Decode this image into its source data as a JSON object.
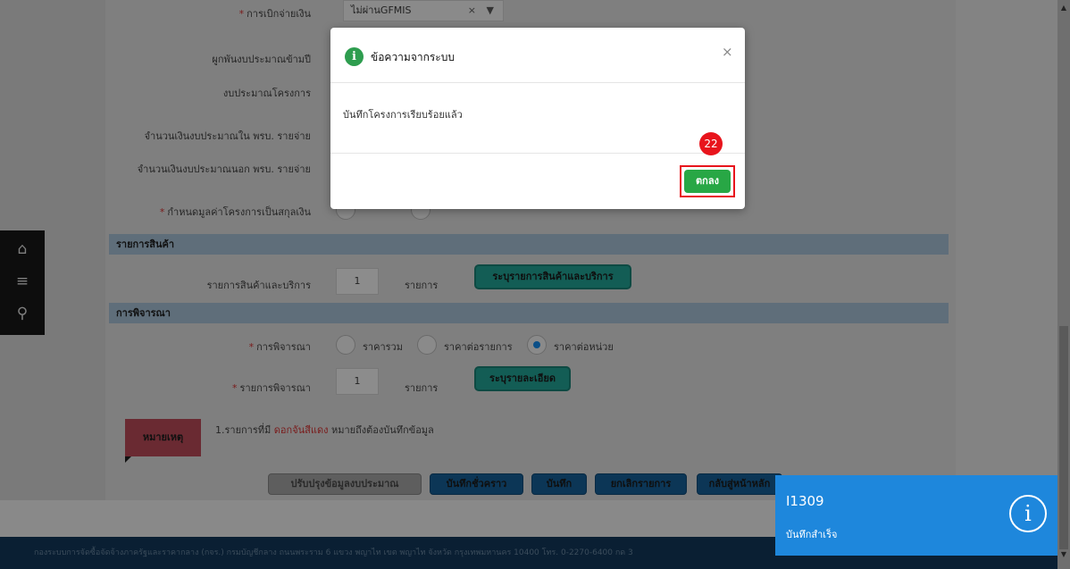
{
  "form": {
    "gfmis_label": "การเบิกจ่ายเงิน",
    "gfmis_value": "ไม่ผ่านGFMIS",
    "gfmis_clear": "×",
    "gfmis_caret": "▼",
    "budget_binding_label": "ผูกพันงบประมาณข้ามปี",
    "project_budget_label": "งบประมาณโครงการ",
    "budget_in_label": "จำนวนเงินงบประมาณใน พรบ. รายจ่าย",
    "budget_out_label": "จำนวนเงินงบประมาณนอก พรบ. รายจ่าย",
    "emergency_label": "กำหนดมูลค่าโครงการเป็นสกุลเงิน"
  },
  "sections": {
    "items_title": "รายการสินค้า",
    "consider_title": "การพิจารณา"
  },
  "items": {
    "label": "รายการสินค้าและบริการ",
    "count": "1",
    "unit": "รายการ",
    "button": "ระบุรายการสินค้าและบริการ"
  },
  "consider": {
    "method_label": "การพิจารณา",
    "options": [
      "ราคารวม",
      "ราคาต่อรายการ",
      "ราคาต่อหน่วย"
    ],
    "selected": "ราคาต่อหน่วย",
    "list_label": "รายการพิจารณา",
    "count": "1",
    "unit": "รายการ",
    "detail_button": "ระบุรายละเอียด"
  },
  "note": {
    "tag": "หมายเหตุ",
    "text_prefix": "1.รายการที่มี ",
    "text_red": "ดอกจันสีแดง",
    "text_suffix": " หมายถึงต้องบันทึกข้อมูล"
  },
  "actions": {
    "update_budget": "ปรับปรุงข้อมูลงบประมาณ",
    "save_draft": "บันทึกชั่วคราว",
    "save": "บันทึก",
    "cancel": "ยกเลิกรายการ",
    "back": "กลับสู่หน้าหลัก"
  },
  "modal": {
    "title": "ข้อความจากระบบ",
    "info_glyph": "i",
    "close": "×",
    "message": "บันทึกโครงการเรียบร้อยแล้ว",
    "ok": "ตกลง"
  },
  "step_badge": "22",
  "toast": {
    "code": "I1309",
    "message": "บันทึกสำเร็จ",
    "icon": "i"
  },
  "sidebar": {
    "home_icon": "⌂",
    "menu_icon": "≡",
    "search_icon": "⚲"
  },
  "footer": {
    "text": "กองระบบการจัดซื้อจัดจ้างภาครัฐและราคากลาง (กจร.) กรมบัญชีกลาง ถนนพระราม 6 แขวง พญาไท เขต พญาไท จังหวัด กรุงเทพมหานคร 10400 โทร. 0-2270-6400 กด 3"
  },
  "scrollbar": {
    "up": "▲",
    "down": "▼"
  }
}
